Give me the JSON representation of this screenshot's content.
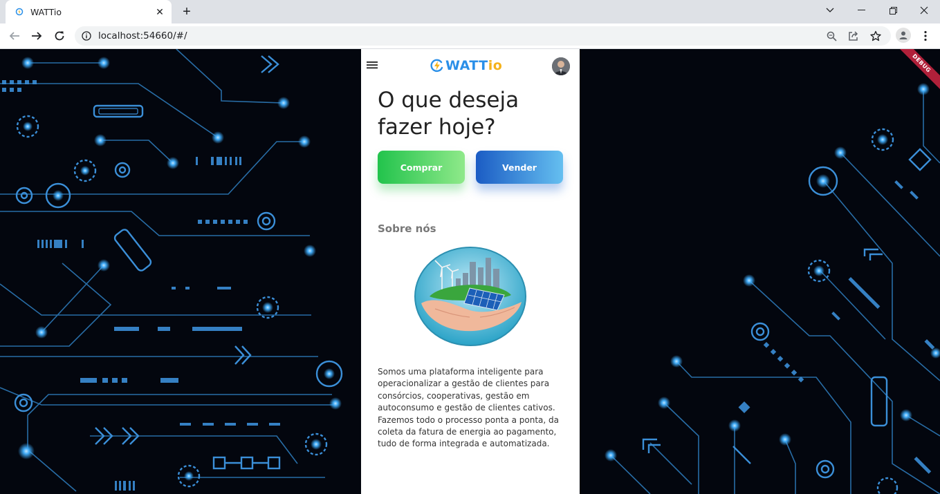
{
  "browser": {
    "tab_title": "WATTio",
    "url": "localhost:54660/#/"
  },
  "debug_banner": "DEBUG",
  "app": {
    "logo": {
      "prefix": "WATT",
      "suffix": "io"
    },
    "headline": "O que deseja fazer hoje?",
    "buy_label": "Comprar",
    "sell_label": "Vender",
    "about_title": "Sobre nós",
    "about_text": "Somos uma plataforma inteligente para operacionalizar a gestão de clientes para consórcios, cooperativas, gestão em autoconsumo e gestão de clientes cativos. Fazemos todo o processo ponta a ponta, da coleta da fatura de energia ao pagamento, tudo de forma integrada e automatizada."
  },
  "icons": {
    "tab_favicon": "wattio-favicon",
    "tab_close": "close-icon",
    "new_tab": "plus-icon",
    "back": "arrow-left-icon",
    "forward": "arrow-right-icon",
    "reload": "reload-icon",
    "site_info": "info-icon",
    "zoom": "zoom-icon",
    "share": "share-icon",
    "bookmark": "star-icon",
    "profile": "person-icon",
    "menu": "hamburger-icon"
  },
  "colors": {
    "brand_blue": "#2a8fe8",
    "brand_yellow": "#f5b21a",
    "buy_green": "#22c34c",
    "sell_blue": "#1b5cc4",
    "background": "#03060e",
    "circuit": "#3fa9f5"
  }
}
